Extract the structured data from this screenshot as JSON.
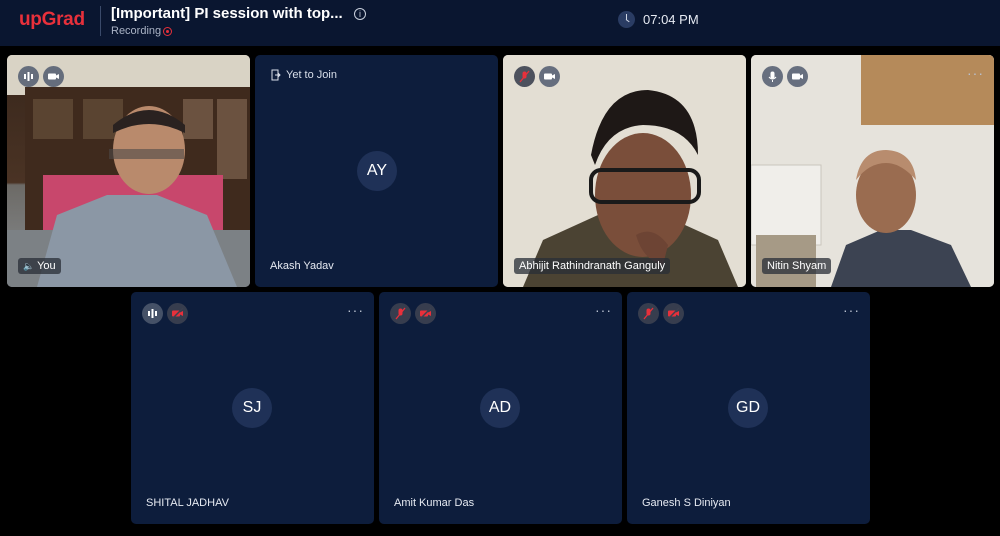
{
  "header": {
    "logo": "upGrad",
    "title": "[Important] PI session with top...",
    "recording_label": "Recording",
    "time": "07:04 PM"
  },
  "tiles": [
    {
      "name": "You",
      "type": "video"
    },
    {
      "name": "Akash Yadav",
      "initials": "AY",
      "status": "Yet to Join",
      "type": "avatar"
    },
    {
      "name": "Abhijit Rathindranath Ganguly",
      "type": "video"
    },
    {
      "name": "Nitin Shyam",
      "type": "video"
    },
    {
      "name": "SHITAL JADHAV",
      "initials": "SJ",
      "type": "avatar"
    },
    {
      "name": "Amit Kumar Das",
      "initials": "AD",
      "type": "avatar"
    },
    {
      "name": "Ganesh S Diniyan",
      "initials": "GD",
      "type": "avatar"
    }
  ],
  "colors": {
    "brand": "#e8303b",
    "topbar": "#0a1630",
    "tile": "#0d1d3c",
    "avatar": "#1f3157"
  },
  "icons": {
    "mic_active": "sound-wave-icon",
    "mic_muted": "mic-off-icon",
    "camera": "camera-icon",
    "camera_off": "camera-off-icon",
    "more": "more-icon",
    "join": "door-enter-icon",
    "clock": "clock-icon",
    "info": "info-icon"
  }
}
